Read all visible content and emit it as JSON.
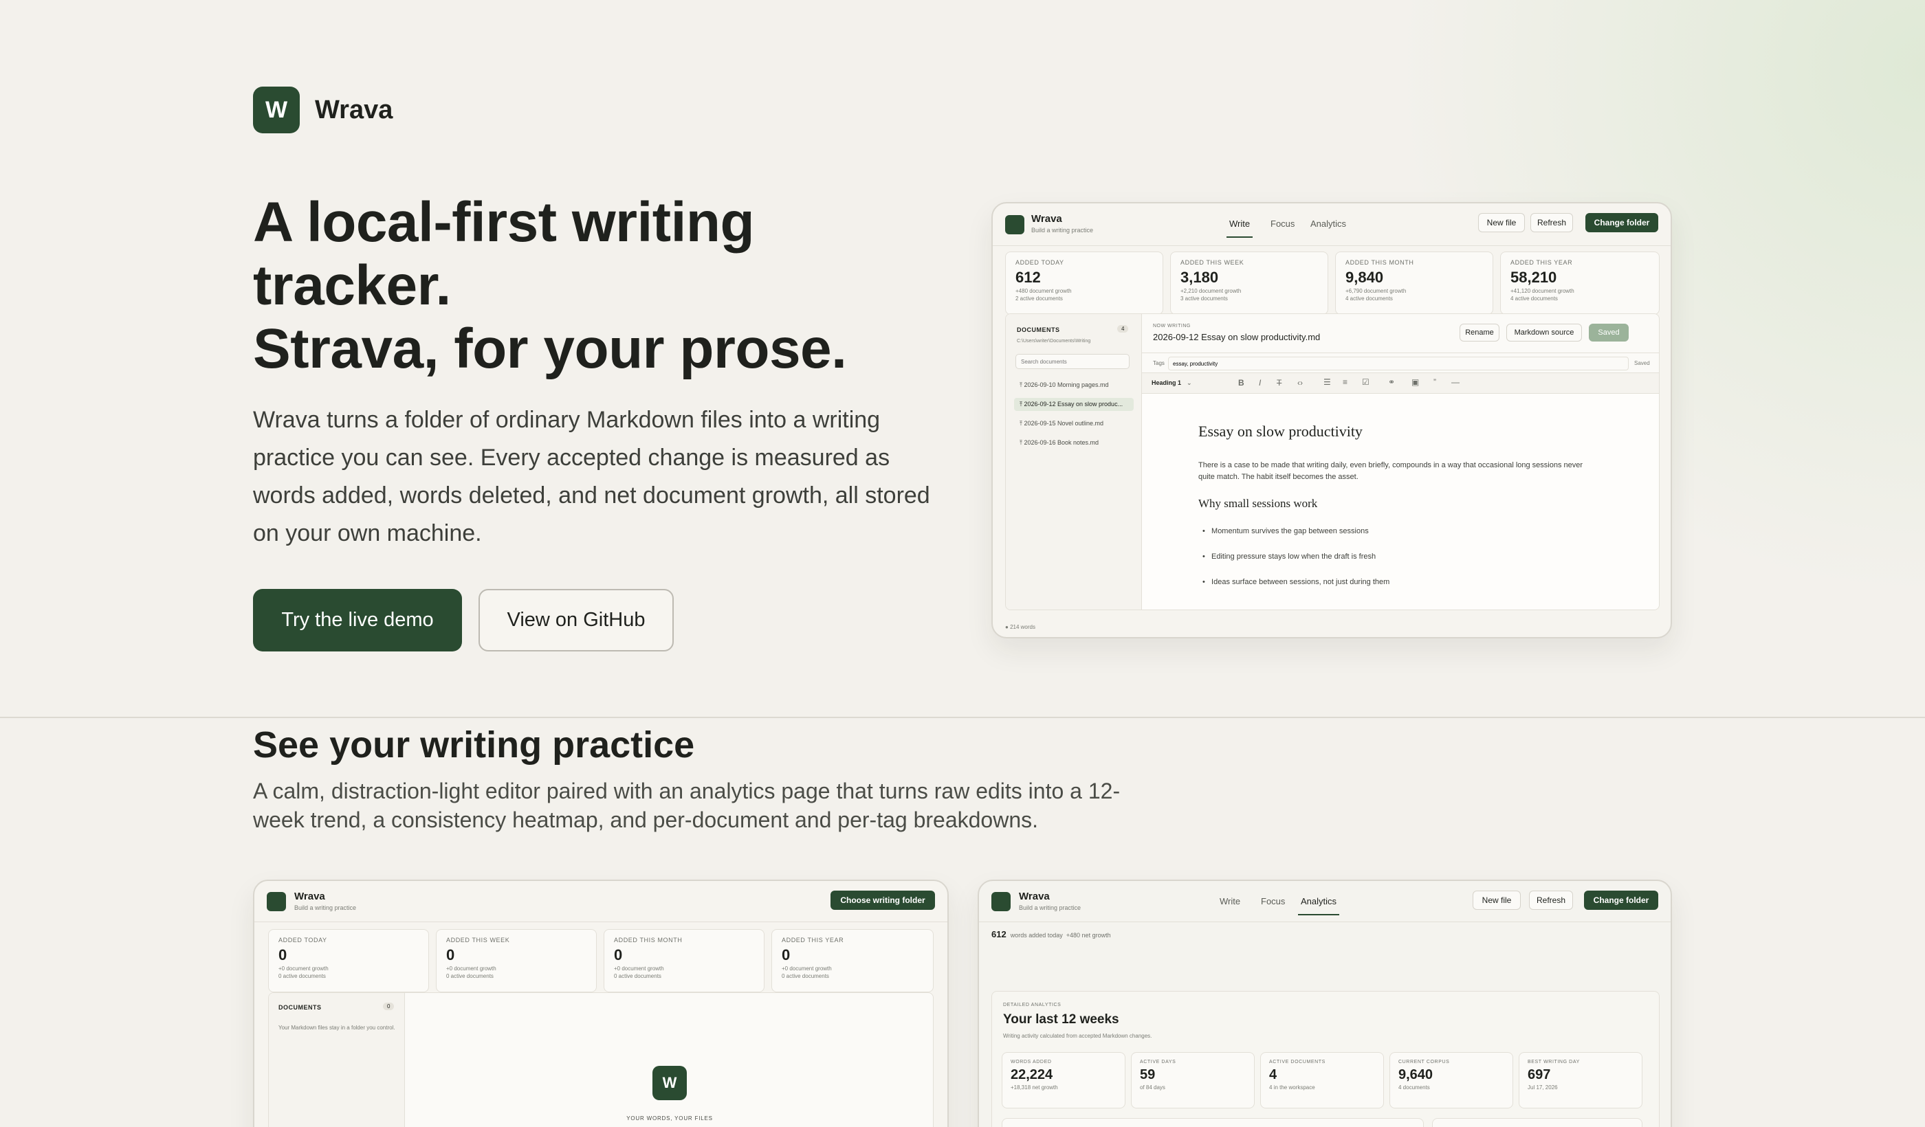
{
  "brand": {
    "logo_letter": "W",
    "name": "Wrava"
  },
  "hero": {
    "title_line1": "A local-first writing",
    "title_line2": "tracker.",
    "title_line3": "Strava, for your prose.",
    "description": "Wrava turns a folder of ordinary Markdown files into a writing practice you can see. Every accepted change is measured as words added, words deleted, and net document growth, all stored on your own machine.",
    "primary_button": "Try the live demo",
    "secondary_button": "View on GitHub"
  },
  "section": {
    "title": "See your writing practice",
    "description": "A calm, distraction-light editor paired with an analytics page that turns raw edits into a 12-week trend, a consistency heatmap, and per-document and per-tag breakdowns."
  },
  "mock_main": {
    "app_name": "Wrava",
    "app_sub": "Build a writing practice",
    "tabs": [
      "Write",
      "Focus",
      "Analytics"
    ],
    "buttons": {
      "new_file": "New file",
      "refresh": "Refresh",
      "change_folder": "Change folder"
    },
    "stats": [
      {
        "label": "ADDED TODAY",
        "value": "612",
        "sub1": "+480 document growth",
        "sub2": "2 active documents"
      },
      {
        "label": "ADDED THIS WEEK",
        "value": "3,180",
        "sub1": "+2,210 document growth",
        "sub2": "3 active documents"
      },
      {
        "label": "ADDED THIS MONTH",
        "value": "9,840",
        "sub1": "+6,790 document growth",
        "sub2": "4 active documents"
      },
      {
        "label": "ADDED THIS YEAR",
        "value": "58,210",
        "sub1": "+41,120 document growth",
        "sub2": "4 active documents"
      }
    ],
    "documents": {
      "header": "DOCUMENTS",
      "count": "4",
      "path": "C:\\Users\\writer\\Documents\\Writing",
      "search_placeholder": "Search documents",
      "items": [
        "2026-09-10 Morning pages.md",
        "2026-09-12 Essay on slow produc...",
        "2026-09-15 Novel outline.md",
        "2026-09-16 Book notes.md"
      ]
    },
    "editor": {
      "now_writing_label": "NOW WRITING",
      "file_name": "2026-09-12 Essay on slow productivity.md",
      "rename": "Rename",
      "markdown_source": "Markdown source",
      "saved": "Saved",
      "tags_label": "Tags",
      "tags_value": "essay, productivity",
      "tags_status": "Saved",
      "heading_select": "Heading 1",
      "doc_title": "Essay on slow productivity",
      "paragraph": "There is a case to be made that writing daily, even briefly, compounds in a way that occasional long sessions never quite match. The habit itself becomes the asset.",
      "subheading": "Why small sessions work",
      "bullets": [
        "Momentum survives the gap between sessions",
        "Editing pressure stays low when the draft is fresh",
        "Ideas surface between sessions, not just during them"
      ]
    },
    "footer": "214 words"
  },
  "mock_left": {
    "app_name": "Wrava",
    "app_sub": "Build a writing practice",
    "button": "Choose writing folder",
    "stats": [
      {
        "label": "ADDED TODAY",
        "value": "0",
        "sub1": "+0 document growth",
        "sub2": "0 active documents"
      },
      {
        "label": "ADDED THIS WEEK",
        "value": "0",
        "sub1": "+0 document growth",
        "sub2": "0 active documents"
      },
      {
        "label": "ADDED THIS MONTH",
        "value": "0",
        "sub1": "+0 document growth",
        "sub2": "0 active documents"
      },
      {
        "label": "ADDED THIS YEAR",
        "value": "0",
        "sub1": "+0 document growth",
        "sub2": "0 active documents"
      }
    ],
    "documents_header": "DOCUMENTS",
    "documents_count": "0",
    "documents_note": "Your Markdown files stay in a folder you control.",
    "empty_logo": "W",
    "empty_caption": "YOUR WORDS, YOUR FILES"
  },
  "mock_right": {
    "app_name": "Wrava",
    "app_sub": "Build a writing practice",
    "tabs": [
      "Write",
      "Focus",
      "Analytics"
    ],
    "buttons": {
      "new_file": "New file",
      "refresh": "Refresh",
      "change_folder": "Change folder"
    },
    "summary_value": "612",
    "summary_text": "words added today",
    "summary_growth": "+480 net growth",
    "analytics_label": "DETAILED ANALYTICS",
    "analytics_title": "Your last 12 weeks",
    "analytics_sub": "Writing activity calculated from accepted Markdown changes.",
    "cards": [
      {
        "label": "WORDS ADDED",
        "value": "22,224",
        "sub": "+18,318 net growth"
      },
      {
        "label": "ACTIVE DAYS",
        "value": "59",
        "sub": "of 84 days"
      },
      {
        "label": "ACTIVE DOCUMENTS",
        "value": "4",
        "sub": "4 in the workspace"
      },
      {
        "label": "CURRENT CORPUS",
        "value": "9,640",
        "sub": "4 documents"
      },
      {
        "label": "BEST WRITING DAY",
        "value": "697",
        "sub": "Jul 17, 2026"
      }
    ]
  },
  "colors": {
    "accent": "#2a4b31",
    "background": "#f3f1ec"
  },
  "icons": [
    "bold-icon",
    "italic-icon",
    "strikethrough-icon",
    "code-icon",
    "bullet-list-icon",
    "numbered-list-icon",
    "task-list-icon",
    "link-icon",
    "image-icon",
    "quote-icon",
    "divider-icon",
    "chevron-down-icon",
    "file-icon"
  ]
}
